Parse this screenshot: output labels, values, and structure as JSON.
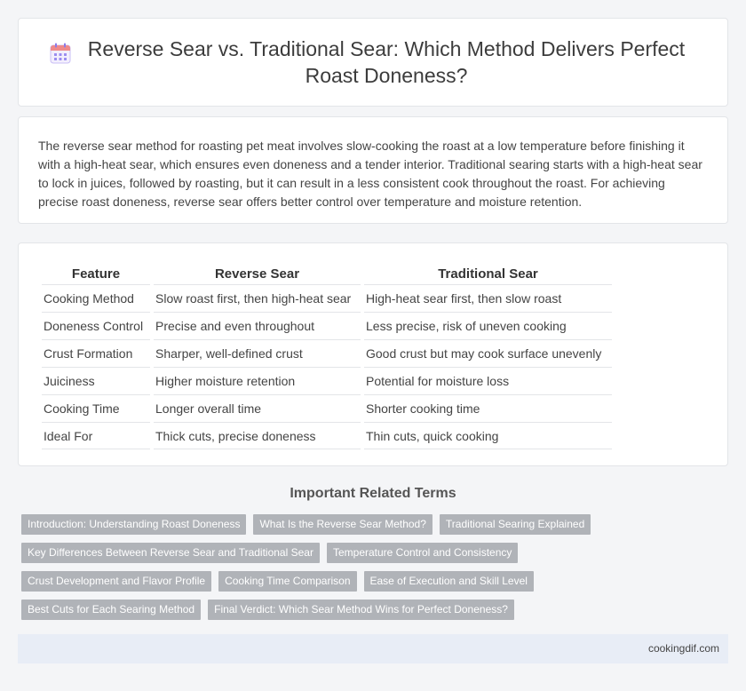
{
  "header": {
    "title": "Reverse Sear vs. Traditional Sear: Which Method Delivers Perfect Roast Doneness?",
    "icon": "calendar-icon"
  },
  "intro": {
    "text": "The reverse sear method for roasting pet meat involves slow-cooking the roast at a low temperature before finishing it with a high-heat sear, which ensures even doneness and a tender interior. Traditional searing starts with a high-heat sear to lock in juices, followed by roasting, but it can result in a less consistent cook throughout the roast. For achieving precise roast doneness, reverse sear offers better control over temperature and moisture retention."
  },
  "table": {
    "headers": [
      "Feature",
      "Reverse Sear",
      "Traditional Sear"
    ],
    "rows": [
      [
        "Cooking Method",
        "Slow roast first, then high-heat sear",
        "High-heat sear first, then slow roast"
      ],
      [
        "Doneness Control",
        "Precise and even throughout",
        "Less precise, risk of uneven cooking"
      ],
      [
        "Crust Formation",
        "Sharper, well-defined crust",
        "Good crust but may cook surface unevenly"
      ],
      [
        "Juiciness",
        "Higher moisture retention",
        "Potential for moisture loss"
      ],
      [
        "Cooking Time",
        "Longer overall time",
        "Shorter cooking time"
      ],
      [
        "Ideal For",
        "Thick cuts, precise doneness",
        "Thin cuts, quick cooking"
      ]
    ]
  },
  "related": {
    "heading": "Important Related Terms",
    "terms": [
      "Introduction: Understanding Roast Doneness",
      "What Is the Reverse Sear Method?",
      "Traditional Searing Explained",
      "Key Differences Between Reverse Sear and Traditional Sear",
      "Temperature Control and Consistency",
      "Crust Development and Flavor Profile",
      "Cooking Time Comparison",
      "Ease of Execution and Skill Level",
      "Best Cuts for Each Searing Method",
      "Final Verdict: Which Sear Method Wins for Perfect Doneness?"
    ]
  },
  "footer": {
    "site": "cookingdif.com"
  },
  "colors": {
    "tag_bg": "#b0b3b8",
    "footer_bg": "#e8edf6",
    "icon_accent": "#7b68ee"
  }
}
